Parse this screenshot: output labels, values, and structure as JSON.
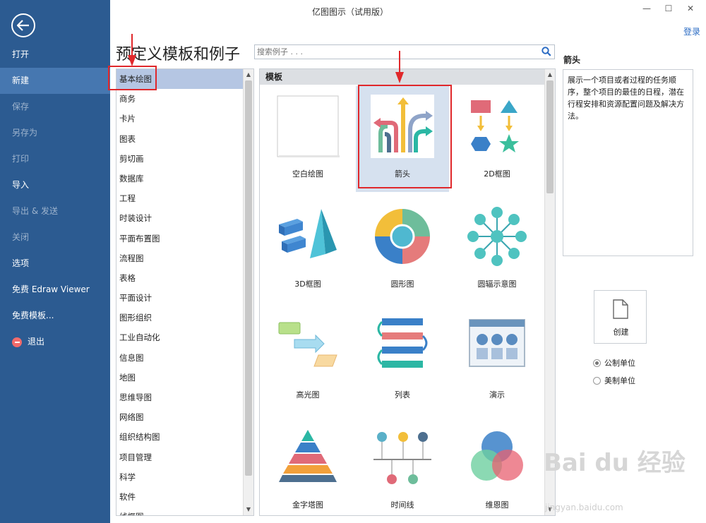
{
  "window": {
    "title": "亿图图示（试用版）",
    "minimize": "—",
    "maximize": "☐",
    "close": "✕",
    "login": "登录"
  },
  "nav": {
    "items": [
      {
        "label": "打开",
        "state": "normal"
      },
      {
        "label": "新建",
        "state": "active"
      },
      {
        "label": "保存",
        "state": "disabled"
      },
      {
        "label": "另存为",
        "state": "disabled"
      },
      {
        "label": "打印",
        "state": "disabled"
      },
      {
        "label": "导入",
        "state": "normal"
      },
      {
        "label": "导出 & 发送",
        "state": "disabled"
      },
      {
        "label": "关闭",
        "state": "disabled"
      },
      {
        "label": "选项",
        "state": "normal"
      },
      {
        "label": "免费 Edraw Viewer",
        "state": "normal"
      },
      {
        "label": "免费模板...",
        "state": "normal"
      },
      {
        "label": "退出",
        "state": "normal"
      }
    ]
  },
  "main": {
    "heading": "预定义模板和例子",
    "search_placeholder": "搜索例子 . . .",
    "categories": [
      "基本绘图",
      "商务",
      "卡片",
      "图表",
      "剪切画",
      "数据库",
      "工程",
      "时装设计",
      "平面布置图",
      "流程图",
      "表格",
      "平面设计",
      "图形组织",
      "工业自动化",
      "信息图",
      "地图",
      "思维导图",
      "网络图",
      "组织结构图",
      "项目管理",
      "科学",
      "软件",
      "线框图"
    ],
    "selected_category": "基本绘图",
    "templates_header": "模板",
    "templates": [
      {
        "label": "空白绘图",
        "icon": "blank-page-icon"
      },
      {
        "label": "箭头",
        "icon": "arrows-icon"
      },
      {
        "label": "2D框图",
        "icon": "2d-block-icon"
      },
      {
        "label": "3D框图",
        "icon": "3d-block-icon"
      },
      {
        "label": "圆形图",
        "icon": "circle-chart-icon"
      },
      {
        "label": "圆辐示意图",
        "icon": "radial-diagram-icon"
      },
      {
        "label": "高光图",
        "icon": "highlight-icon"
      },
      {
        "label": "列表",
        "icon": "list-icon"
      },
      {
        "label": "演示",
        "icon": "presentation-icon"
      },
      {
        "label": "金字塔图",
        "icon": "pyramid-icon"
      },
      {
        "label": "时间线",
        "icon": "timeline-icon"
      },
      {
        "label": "维恩图",
        "icon": "venn-icon"
      }
    ],
    "selected_template": "箭头"
  },
  "details": {
    "title": "箭头",
    "description": "展示一个项目或者过程的任务顺序，整个项目的最佳的日程，潜在行程安排和资源配置问题及解决方法。",
    "create_label": "创建",
    "units": [
      {
        "label": "公制单位",
        "checked": true
      },
      {
        "label": "美制单位",
        "checked": false
      }
    ]
  },
  "watermark": {
    "brand": "Bai du 经验",
    "url": "jingyan.baidu.com"
  },
  "colors": {
    "nav_bg": "#2c5b91",
    "nav_active": "#4677b0",
    "accent_red": "#e0282b",
    "selection": "#b5c6e3"
  }
}
